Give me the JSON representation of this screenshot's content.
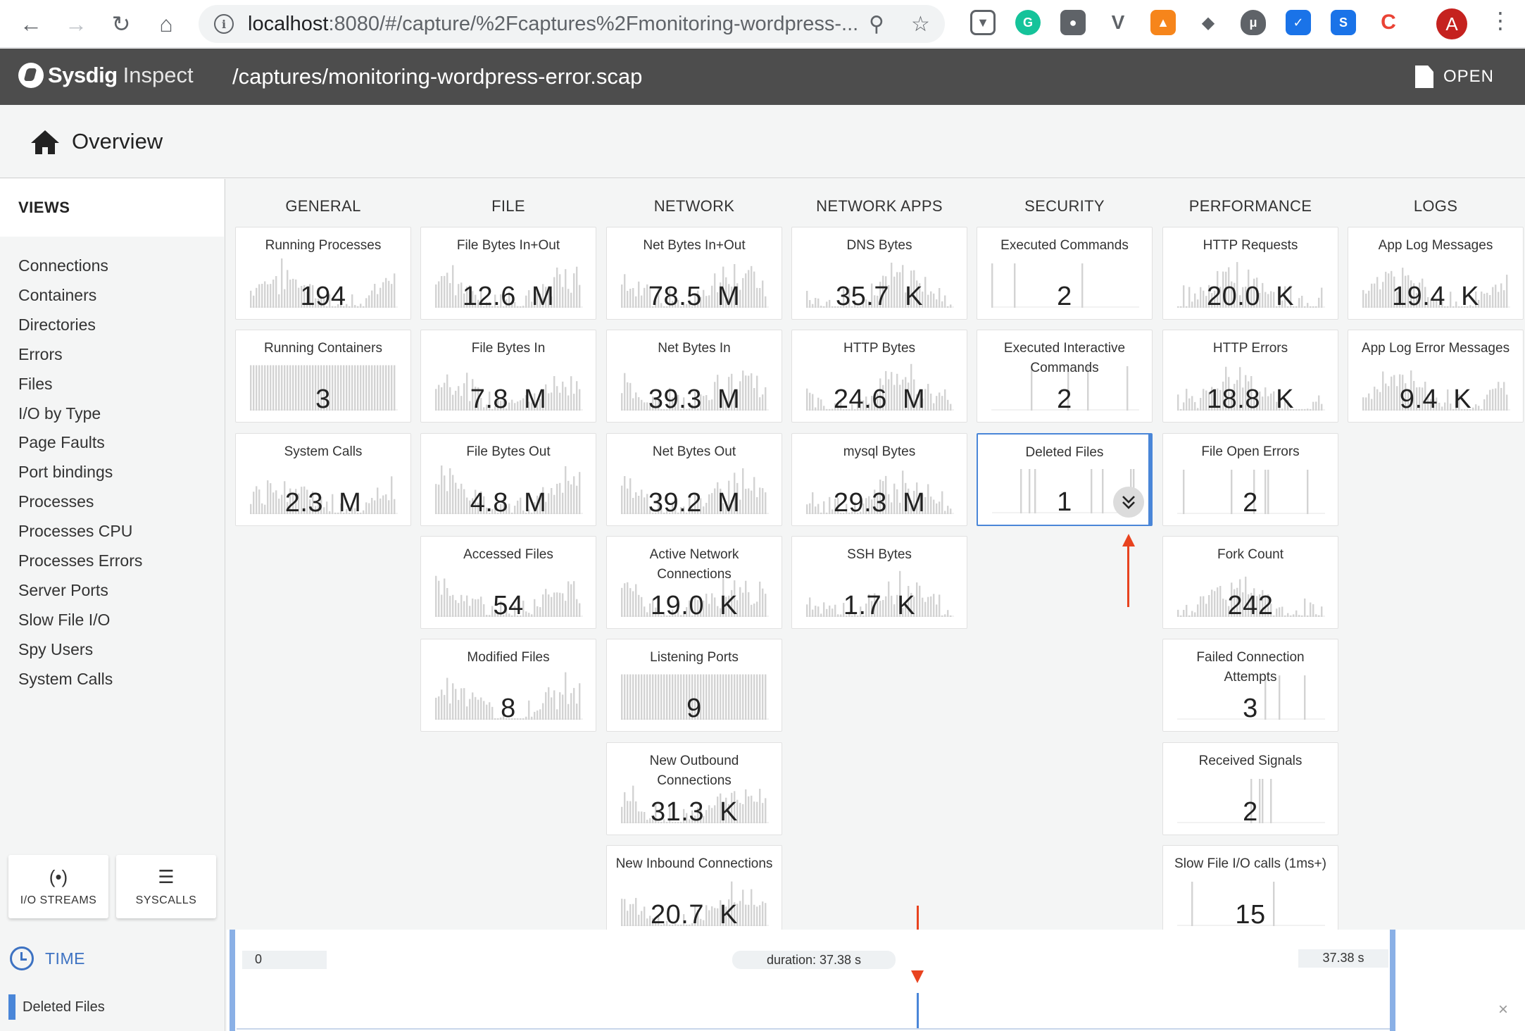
{
  "browser": {
    "url_host": "localhost",
    "url_rest": ":8080/#/capture/%2Fcaptures%2Fmonitoring-wordpress-...",
    "avatar_letter": "A"
  },
  "app": {
    "brand": "Sysdig",
    "brand_sub": "Inspect",
    "capture_path": "/captures/monitoring-wordpress-error.scap",
    "open_label": "OPEN"
  },
  "breadcrumb": {
    "title": "Overview"
  },
  "sidebar": {
    "views_title": "VIEWS",
    "items": [
      "Connections",
      "Containers",
      "Directories",
      "Errors",
      "Files",
      "I/O by Type",
      "Page Faults",
      "Port bindings",
      "Processes",
      "Processes CPU",
      "Processes Errors",
      "Server Ports",
      "Slow File I/O",
      "Spy Users",
      "System Calls"
    ],
    "io_streams_label": "I/O STREAMS",
    "syscalls_label": "SYSCALLS",
    "time_label": "TIME",
    "active_filter": "Deleted Files"
  },
  "columns": [
    {
      "header": "GENERAL",
      "tiles": [
        {
          "title": "Running Processes",
          "value": "194"
        },
        {
          "title": "Running Containers",
          "value": "3"
        },
        {
          "title": "System Calls",
          "value": "2.3  M"
        }
      ]
    },
    {
      "header": "FILE",
      "tiles": [
        {
          "title": "File Bytes In+Out",
          "value": "12.6  M"
        },
        {
          "title": "File Bytes In",
          "value": "7.8  M"
        },
        {
          "title": "File Bytes Out",
          "value": "4.8  M"
        },
        {
          "title": "Accessed Files",
          "value": "54"
        },
        {
          "title": "Modified Files",
          "value": "8"
        }
      ]
    },
    {
      "header": "NETWORK",
      "tiles": [
        {
          "title": "Net Bytes In+Out",
          "value": "78.5  M"
        },
        {
          "title": "Net Bytes In",
          "value": "39.3  M"
        },
        {
          "title": "Net Bytes Out",
          "value": "39.2  M"
        },
        {
          "title": "Active Network Connections",
          "value": "19.0  K"
        },
        {
          "title": "Listening Ports",
          "value": "9"
        },
        {
          "title": "New Outbound Connections",
          "value": "31.3  K"
        },
        {
          "title": "New Inbound Connections",
          "value": "20.7  K"
        }
      ]
    },
    {
      "header": "NETWORK APPS",
      "tiles": [
        {
          "title": "DNS Bytes",
          "value": "35.7  K"
        },
        {
          "title": "HTTP Bytes",
          "value": "24.6  M"
        },
        {
          "title": "mysql Bytes",
          "value": "29.3  M"
        },
        {
          "title": "SSH Bytes",
          "value": "1.7  K"
        }
      ]
    },
    {
      "header": "SECURITY",
      "tiles": [
        {
          "title": "Executed Commands",
          "value": "2"
        },
        {
          "title": "Executed Interactive Commands",
          "value": "2"
        },
        {
          "title": "Deleted Files",
          "value": "1"
        }
      ]
    },
    {
      "header": "PERFORMANCE",
      "tiles": [
        {
          "title": "HTTP Requests",
          "value": "20.0  K"
        },
        {
          "title": "HTTP Errors",
          "value": "18.8  K"
        },
        {
          "title": "File Open Errors",
          "value": "2"
        },
        {
          "title": "Fork Count",
          "value": "242"
        },
        {
          "title": "Failed Connection Attempts",
          "value": "3"
        },
        {
          "title": "Received Signals",
          "value": "2"
        },
        {
          "title": "Slow File I/O calls (1ms+)",
          "value": "15"
        }
      ]
    },
    {
      "header": "LOGS",
      "tiles": [
        {
          "title": "App Log Messages",
          "value": "19.4  K"
        },
        {
          "title": "App Log Error Messages",
          "value": "9.4  K"
        }
      ]
    }
  ],
  "timebar": {
    "start": "0",
    "duration": "duration: 37.38 s",
    "end": "37.38 s",
    "close_glyph": "×"
  },
  "colors": {
    "accent": "#4a86d8",
    "annotation_arrow": "#e8431f",
    "header_bg": "#4d4d4d"
  }
}
